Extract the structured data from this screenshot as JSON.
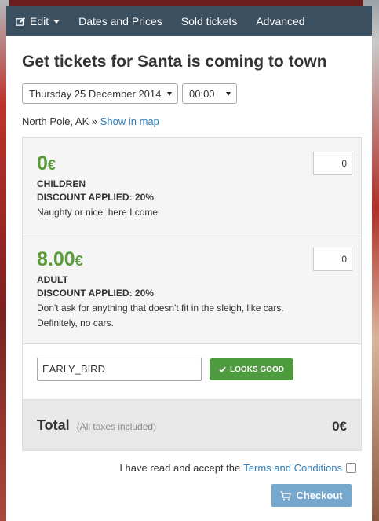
{
  "nav": {
    "edit": "Edit",
    "dates": "Dates and Prices",
    "sold": "Sold tickets",
    "advanced": "Advanced"
  },
  "title": "Get tickets for Santa is coming to town",
  "date_select": {
    "value": "Thursday 25 December 2014"
  },
  "time_select": {
    "value": "00:00"
  },
  "location": {
    "place": "North Pole, AK »",
    "link": "Show in map"
  },
  "tickets": [
    {
      "price": "0",
      "currency": "€",
      "name": "CHILDREN",
      "discount": "DISCOUNT APPLIED: 20%",
      "desc": "Naughty or nice, here I come",
      "qty": "0"
    },
    {
      "price": "8.00",
      "currency": "€",
      "name": "ADULT",
      "discount": "DISCOUNT APPLIED: 20%",
      "desc1": "Don't ask for anything that doesn't fit in the sleigh, like cars.",
      "desc2": "Definitely, no cars.",
      "qty": "0"
    }
  ],
  "promo": {
    "value": "EARLY_BIRD",
    "button": "LOOKS GOOD"
  },
  "total": {
    "label": "Total",
    "note": "(All taxes included)",
    "amount": "0€"
  },
  "terms": {
    "text": "I have read and accept the",
    "link": "Terms and Conditions"
  },
  "checkout": "Checkout",
  "colors": {
    "nav": "#3a4f60",
    "price": "#5a9b3c",
    "promo_btn": "#4e9a3e",
    "checkout": "#76a7cd",
    "link": "#2a7fbf"
  }
}
